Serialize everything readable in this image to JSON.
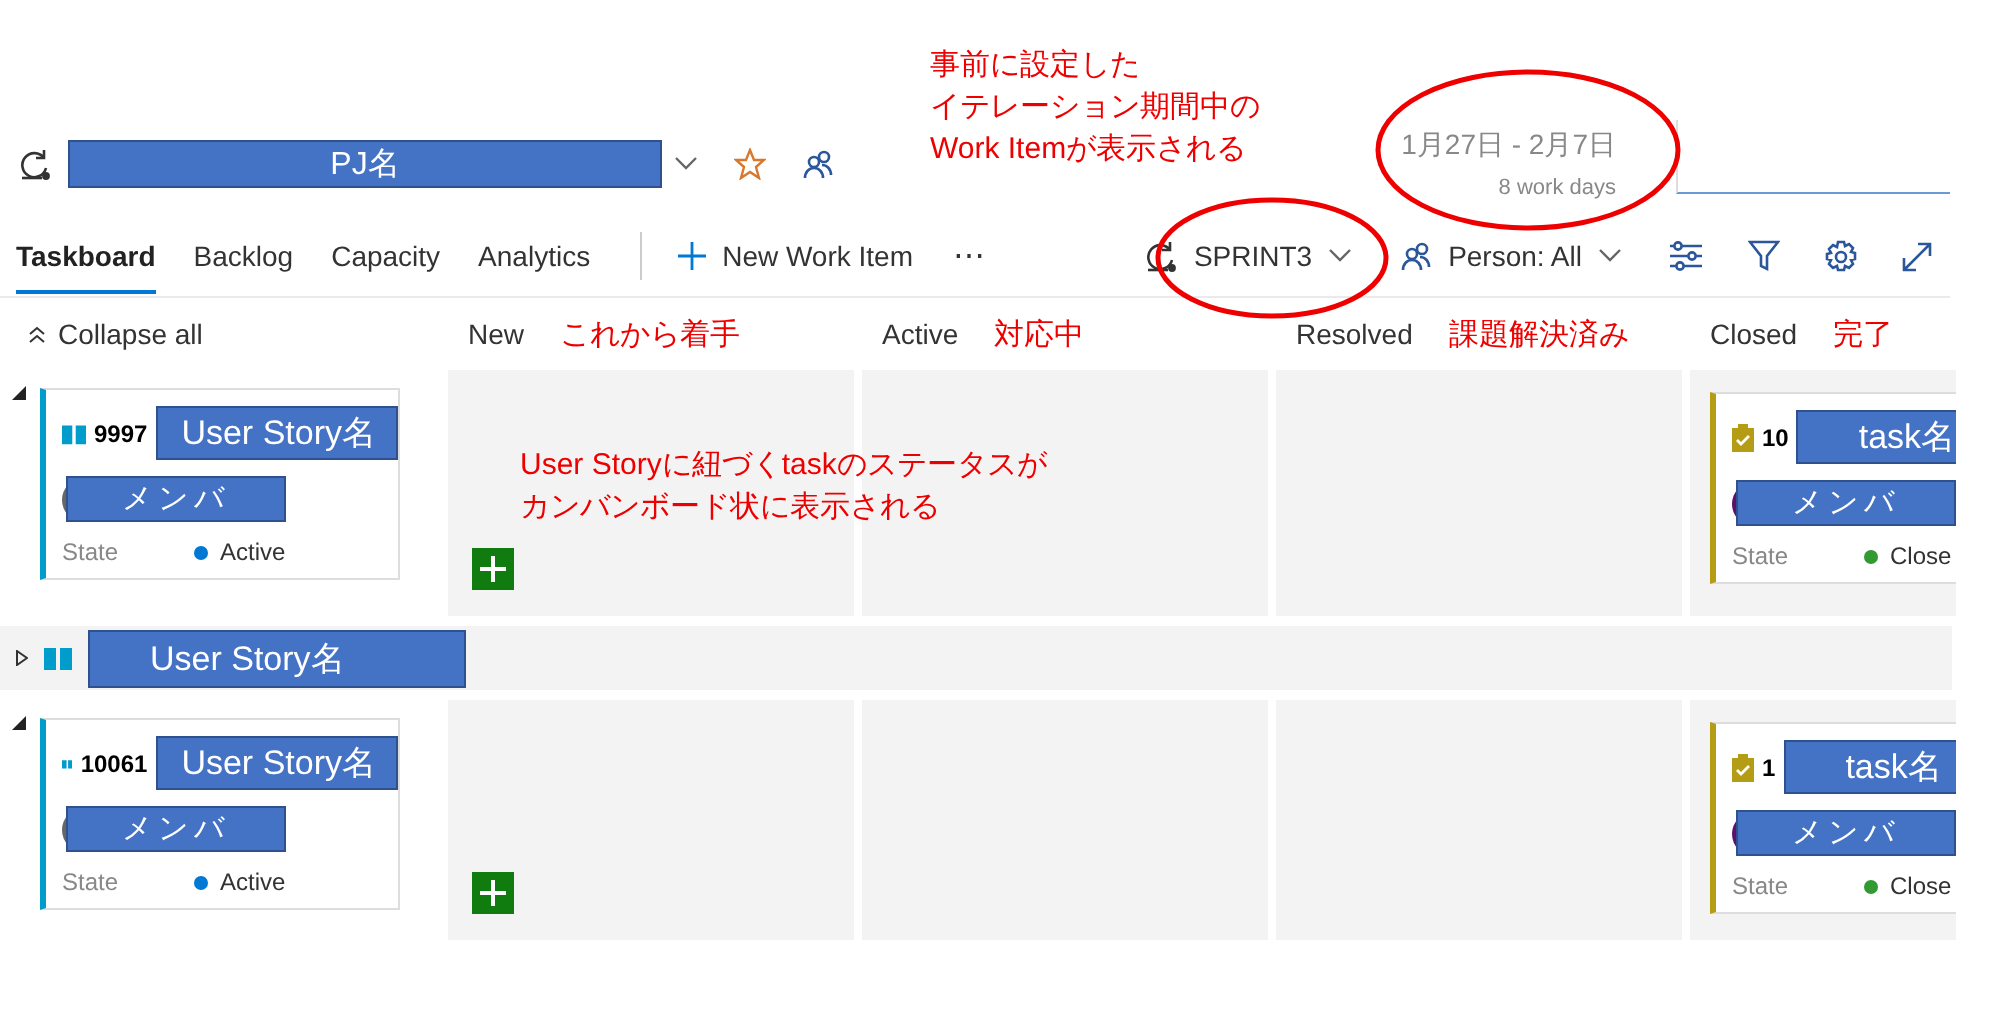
{
  "callout": {
    "lines": [
      "事前に設定した",
      "イテレーション期間中の",
      "Work Itemが表示される"
    ]
  },
  "header": {
    "project_label": "PJ名"
  },
  "iteration": {
    "dates": "1月27日 - 2月7日",
    "work_days": "8 work days"
  },
  "tabs": [
    {
      "label": "Taskboard",
      "selected": true
    },
    {
      "label": "Backlog",
      "selected": false
    },
    {
      "label": "Capacity",
      "selected": false
    },
    {
      "label": "Analytics",
      "selected": false
    }
  ],
  "toolbar": {
    "new_item": "New Work Item",
    "more": "⋯",
    "sprint": "SPRINT3",
    "person_filter": "Person: All"
  },
  "collapse_all": "Collapse all",
  "columns": [
    {
      "label": "New",
      "note": "これから着手"
    },
    {
      "label": "Active",
      "note": "対応中"
    },
    {
      "label": "Resolved",
      "note": "課題解決済み"
    },
    {
      "label": "Closed",
      "note": "完了"
    }
  ],
  "board_note": {
    "lines": [
      "User Storyに紐づくtaskのステータスが",
      "カンバンボード状に表示される"
    ]
  },
  "rows": [
    {
      "expanded": true,
      "story": {
        "id": "9997",
        "title": "User Story名",
        "member": "メンバ",
        "state_label": "State",
        "state": "Active",
        "color": "#0078d4"
      },
      "task": {
        "id": "10",
        "title": "task名",
        "member": "メンバ",
        "state_label": "State",
        "state": "Close",
        "color": "#339933"
      }
    },
    {
      "expanded": false,
      "story": {
        "title": "User Story名"
      }
    },
    {
      "expanded": true,
      "story": {
        "id": "10061",
        "title": "User Story名",
        "member": "メンバ",
        "state_label": "State",
        "state": "Active",
        "color": "#0078d4"
      },
      "task": {
        "id": "1",
        "title": "task名",
        "member": "メンバ",
        "state_label": "State",
        "state": "Close",
        "color": "#339933"
      }
    }
  ]
}
